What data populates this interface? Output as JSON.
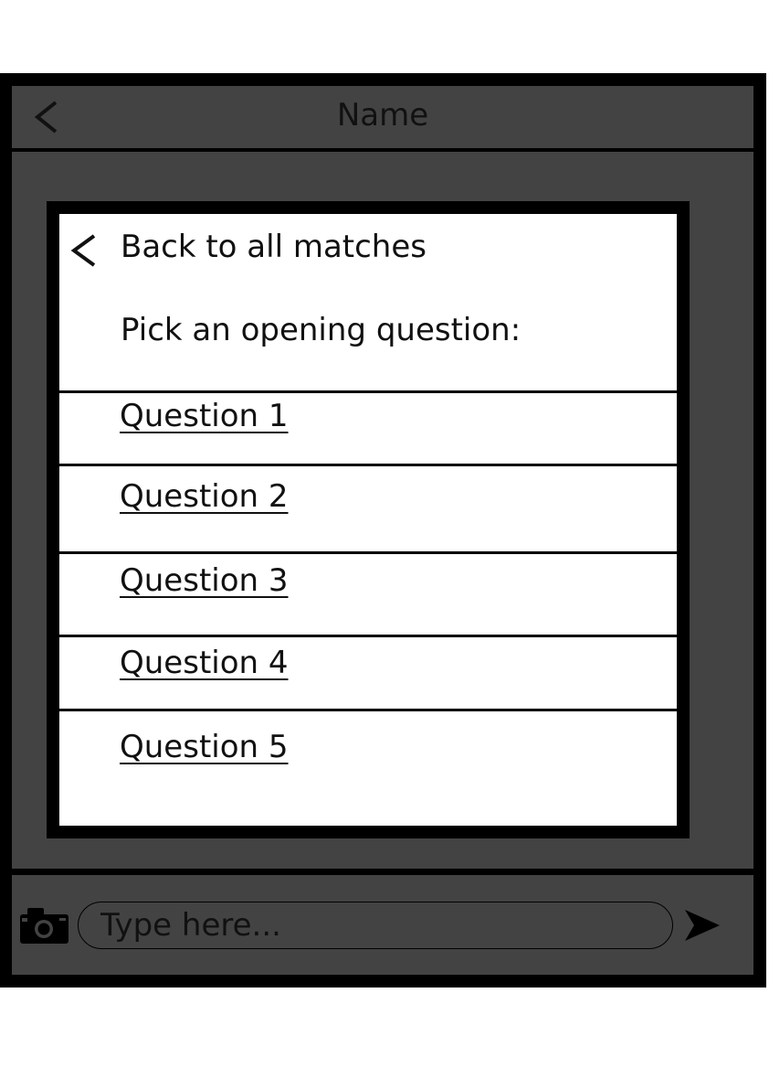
{
  "header": {
    "title": "Name",
    "back_icon": "chevron-left-icon"
  },
  "modal": {
    "back_label": "Back to all matches",
    "back_icon": "chevron-left-icon",
    "prompt": "Pick an opening question:",
    "questions": [
      {
        "label": "Question 1"
      },
      {
        "label": "Question 2"
      },
      {
        "label": "Question 3"
      },
      {
        "label": "Question 4"
      },
      {
        "label": "Question 5"
      }
    ]
  },
  "composer": {
    "placeholder": "Type here...",
    "value": "",
    "camera_icon": "camera-icon",
    "send_icon": "send-icon"
  },
  "colors": {
    "frame": "#000000",
    "panel": "#434343",
    "modal_bg": "#ffffff",
    "text": "#111111"
  }
}
